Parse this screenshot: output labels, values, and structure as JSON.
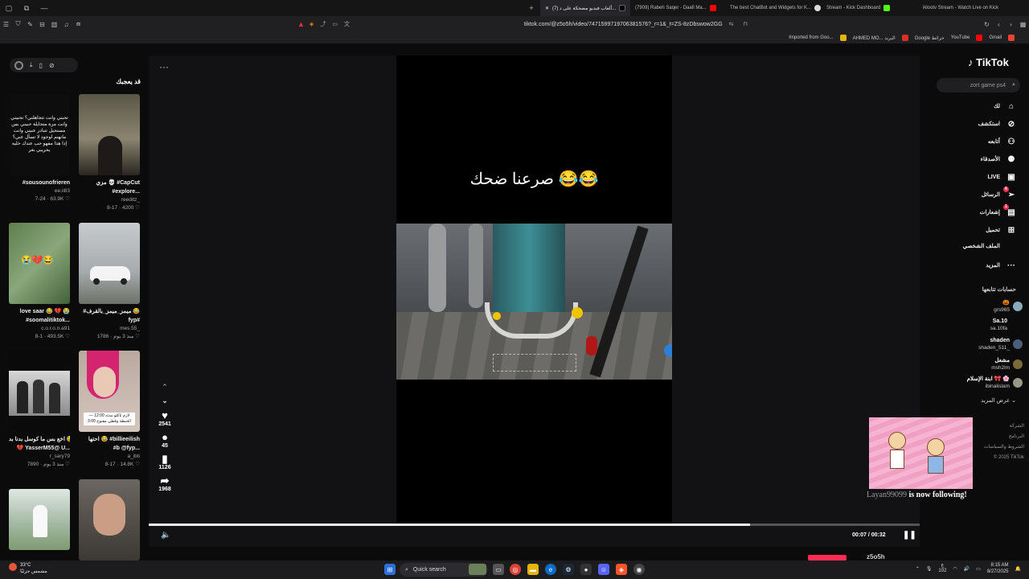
{
  "browser": {
    "tabs": [
      {
        "label": "(7) ألعاب فيديو مضحكة على د...",
        "active": true
      },
      {
        "label": "(7909) Rabeh Saqer - Daafi Ma...",
        "active": false
      },
      {
        "label": "The best ChatBot and Widgets for K...",
        "active": false
      },
      {
        "label": "Stream - Kick Dashboard",
        "active": false
      },
      {
        "label": "iklootv Stream - Watch Live on Kick",
        "active": false
      }
    ],
    "url": "tiktok.com/@z5o5h/video/7471599719706381576?_r=1&_t=ZS-8zDbswow2GG",
    "bookmarks": [
      "Imported from Goo...",
      "AHMED MO... البريد",
      "Google خرائط",
      "YouTube",
      "Gmail"
    ]
  },
  "left_panel": {
    "heading": "قد يعجبك",
    "cards": [
      {
        "title": "مزي 💀 #CapCut",
        "title2": "#explore...",
        "user": "reeditz_",
        "meta": "8-17 · 4200 ♡"
      },
      {
        "title": "#sousounofrieren",
        "title2": "",
        "user": "ee.ii83",
        "meta": "7-24 · 63.9K ♡"
      },
      {
        "title": "#ميمز_ميمز_بالقرف 😂",
        "title2": "fyp#",
        "user": "mes.55_",
        "meta": "منذ 3 يوم · 1786 ♡"
      },
      {
        "title": "love saar 😂 💔 😭",
        "title2": "#soomalitiktok...",
        "user": "c.o.r.o.n.a91",
        "meta": "8-1 · 493.5K ♡"
      },
      {
        "title": "احتها 😂 #billieeilish",
        "title2": "#b @fyp...",
        "user": "a_ibti",
        "meta": "8-17 · 14.8K ♡"
      },
      {
        "title": "اخع بس ما كوسل بدنا بد 😂",
        "title2": "💔 YasserM55@ U...",
        "user": "r_sary79",
        "meta": "منذ 3 يوم · 7890 ♡"
      },
      {
        "title": "",
        "title2": "",
        "user": "",
        "meta": ""
      },
      {
        "title": "",
        "title2": "",
        "user": "",
        "meta": ""
      }
    ],
    "thumb_overlay_text": "تحبني وانت تتجاهلني؟ تحبيني وانت مرة متحايلة حبيني بس مستحيل تتبادر عنيني وانت مانهتم لوجود لا تسأل عني؟ إذا هذا مفهو حب عندك خليه يحريبي بغر",
    "thumb5_caption": "لازم تاكلو مدته 12:00 — الحيطة وقطي مفتوح 3:00",
    "thumb2_emoji": "😭💔😂"
  },
  "player": {
    "caption_overlay": "صرعنا ضحك 😂😂",
    "likes": "2541",
    "comments": "45",
    "saves": "1126",
    "shares": "1968",
    "time_current": "00:07",
    "time_total": "00:32",
    "progress_fraction": 0.78,
    "more_label": "···"
  },
  "right_panel": {
    "logo": "TikTok",
    "search_placeholder": "zort game ps4",
    "nav": [
      {
        "label": "لك",
        "icon": "home-icon"
      },
      {
        "label": "استكشف",
        "icon": "compass-icon"
      },
      {
        "label": "أتابعه",
        "icon": "following-icon"
      },
      {
        "label": "الأصدقاء",
        "icon": "friends-icon"
      },
      {
        "label": "LIVE",
        "icon": "live-icon"
      },
      {
        "label": "الرسائل",
        "icon": "messages-icon",
        "badge": "6"
      },
      {
        "label": "إشعارات",
        "icon": "notifications-icon",
        "badge": "1"
      },
      {
        "label": "تحميل",
        "icon": "upload-icon"
      },
      {
        "label": "الملف الشخصي",
        "icon": "profile-icon"
      },
      {
        "label": "المزيد",
        "icon": "more-icon"
      }
    ],
    "following_heading": "حسابات تتابعها",
    "following": [
      {
        "name": "🎃",
        "handle": "grs965"
      },
      {
        "name": "Sa.10",
        "handle": "sa.10fa"
      },
      {
        "name": "shaden",
        "handle": "shaden_511_"
      },
      {
        "name": "مشعل",
        "handle": "msh2lm"
      },
      {
        "name": "ابنة الإسلام 🎀 🌸",
        "handle": "ibinalislam"
      }
    ],
    "show_more": "عرض المزيد",
    "footer": [
      "الشركة",
      "البرنامج",
      "الشروط والسياسات",
      "© 2025 TikTok"
    ]
  },
  "stream_overlay": {
    "username": "Layan99099",
    "message": " is now following!"
  },
  "peek_name": "z5o5h",
  "taskbar": {
    "weather_temp": "33°C",
    "weather_desc": "مشمس جزئيًا",
    "search_label": "Quick search",
    "tray_lang": "ع",
    "tray_num": "102",
    "time": "8:15 AM",
    "date": "8/27/2025"
  }
}
